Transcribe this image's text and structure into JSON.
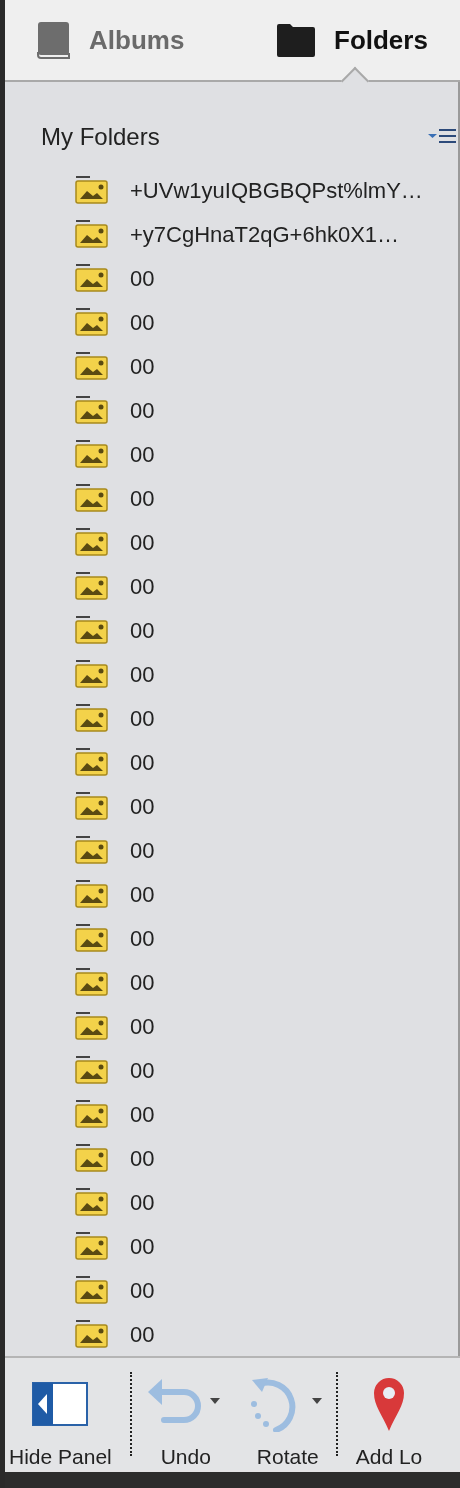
{
  "tabs": [
    {
      "label": "Albums",
      "kind": "album",
      "selected": false
    },
    {
      "label": "Folders",
      "kind": "folder",
      "selected": true
    }
  ],
  "section": {
    "title": "My Folders"
  },
  "folders": [
    {
      "name": "+UVw1yuIQBGBQPst%lmY…"
    },
    {
      "name": "+y7CgHnaT2qG+6hk0X1…"
    },
    {
      "name": "00"
    },
    {
      "name": "00"
    },
    {
      "name": "00"
    },
    {
      "name": "00"
    },
    {
      "name": "00"
    },
    {
      "name": "00"
    },
    {
      "name": "00"
    },
    {
      "name": "00"
    },
    {
      "name": "00"
    },
    {
      "name": "00"
    },
    {
      "name": "00"
    },
    {
      "name": "00"
    },
    {
      "name": "00"
    },
    {
      "name": "00"
    },
    {
      "name": "00"
    },
    {
      "name": "00"
    },
    {
      "name": "00"
    },
    {
      "name": "00"
    },
    {
      "name": "00"
    },
    {
      "name": "00"
    },
    {
      "name": "00"
    },
    {
      "name": "00"
    },
    {
      "name": "00"
    },
    {
      "name": "00"
    },
    {
      "name": "00"
    }
  ],
  "toolbar": [
    {
      "label": "Hide Panel",
      "kind": "panel"
    },
    {
      "kind": "separator"
    },
    {
      "label": "Undo",
      "kind": "undo"
    },
    {
      "label": "Rotate",
      "kind": "rotate"
    },
    {
      "kind": "separator"
    },
    {
      "label": "Add Lo",
      "kind": "location"
    }
  ]
}
